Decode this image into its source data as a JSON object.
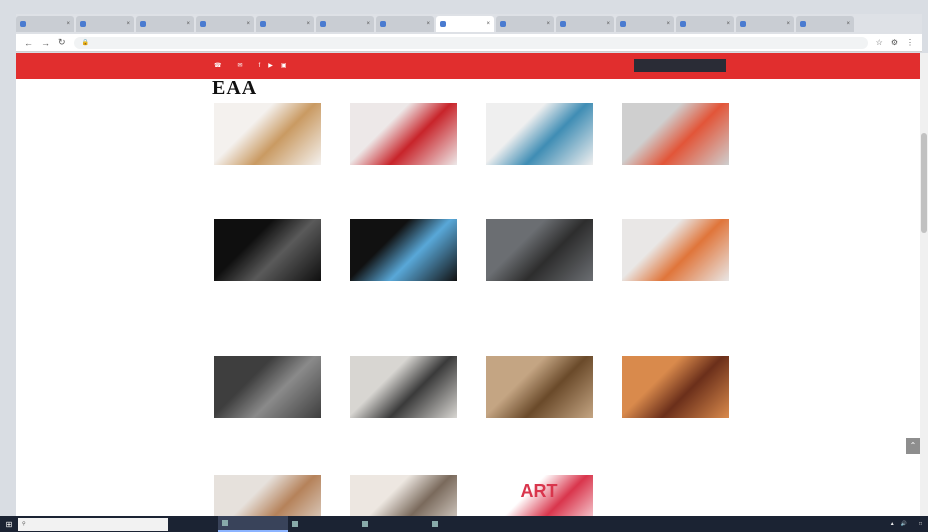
{
  "browser": {
    "tabs": [
      {
        "label": "",
        "active": false
      },
      {
        "label": "",
        "active": false
      },
      {
        "label": "",
        "active": false
      },
      {
        "label": "",
        "active": false
      },
      {
        "label": "",
        "active": false
      },
      {
        "label": "",
        "active": false
      },
      {
        "label": "",
        "active": false
      },
      {
        "label": "",
        "active": true
      },
      {
        "label": "",
        "active": false
      },
      {
        "label": "",
        "active": false
      },
      {
        "label": "",
        "active": false
      },
      {
        "label": "",
        "active": false
      },
      {
        "label": "",
        "active": false
      },
      {
        "label": "",
        "active": false
      }
    ],
    "url": ""
  },
  "site": {
    "contact": {
      "phone": "",
      "email": ""
    },
    "links": [
      "",
      ""
    ],
    "logo": "EAA",
    "language": "",
    "cards": [
      {
        "caption": "",
        "colors": [
          "#f4f1ee",
          "#c99a62"
        ]
      },
      {
        "caption": "",
        "colors": [
          "#ede8e8",
          "#c8242a"
        ]
      },
      {
        "caption": "",
        "colors": [
          "#efefef",
          "#3f8db4"
        ]
      },
      {
        "caption": "",
        "colors": [
          "#cfcfcf",
          "#e25538"
        ]
      },
      {
        "caption": "",
        "colors": [
          "#0f0f0f",
          "#5a5a5a"
        ]
      },
      {
        "caption": "",
        "colors": [
          "#111111",
          "#59a8d8"
        ]
      },
      {
        "caption": "",
        "colors": [
          "#6b6e72",
          "#2d2d2d"
        ]
      },
      {
        "caption": "",
        "colors": [
          "#e9e7e6",
          "#e0753a"
        ]
      },
      {
        "caption": "",
        "colors": [
          "#3e3e3e",
          "#8a8a8a"
        ]
      },
      {
        "caption": "",
        "colors": [
          "#d8d6d2",
          "#3a3a3a"
        ]
      },
      {
        "caption": "",
        "colors": [
          "#c4a583",
          "#6a4a2a"
        ]
      },
      {
        "caption": "",
        "colors": [
          "#d98a4c",
          "#6b2f1a"
        ]
      },
      {
        "caption": "",
        "colors": [
          "#e6e1dc",
          "#b5825a"
        ]
      },
      {
        "caption": "",
        "colors": [
          "#ede7e1",
          "#7a6a5c"
        ]
      },
      {
        "caption": "ART",
        "colors": [
          "#ffffff",
          "#d9354c"
        ]
      }
    ]
  },
  "taskbar": {
    "search_placeholder": "",
    "tasks": [
      {
        "label": "",
        "active": true
      },
      {
        "label": "",
        "active": false
      },
      {
        "label": "",
        "active": false
      },
      {
        "label": "",
        "active": false
      }
    ],
    "clock": ""
  }
}
